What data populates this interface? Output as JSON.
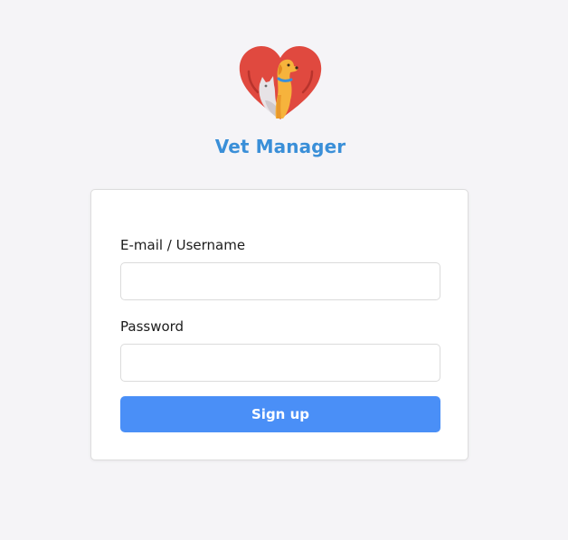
{
  "app": {
    "title": "Vet Manager",
    "logo_icon": "heart-cat-dog-logo-icon"
  },
  "form": {
    "email_label": "E-mail / Username",
    "email_value": "",
    "password_label": "Password",
    "password_value": "",
    "submit_label": "Sign up"
  },
  "colors": {
    "brand_title": "#3a8fd8",
    "button": "#4a8ff7",
    "heart": "#e0493f",
    "background": "#f5f4f7"
  }
}
